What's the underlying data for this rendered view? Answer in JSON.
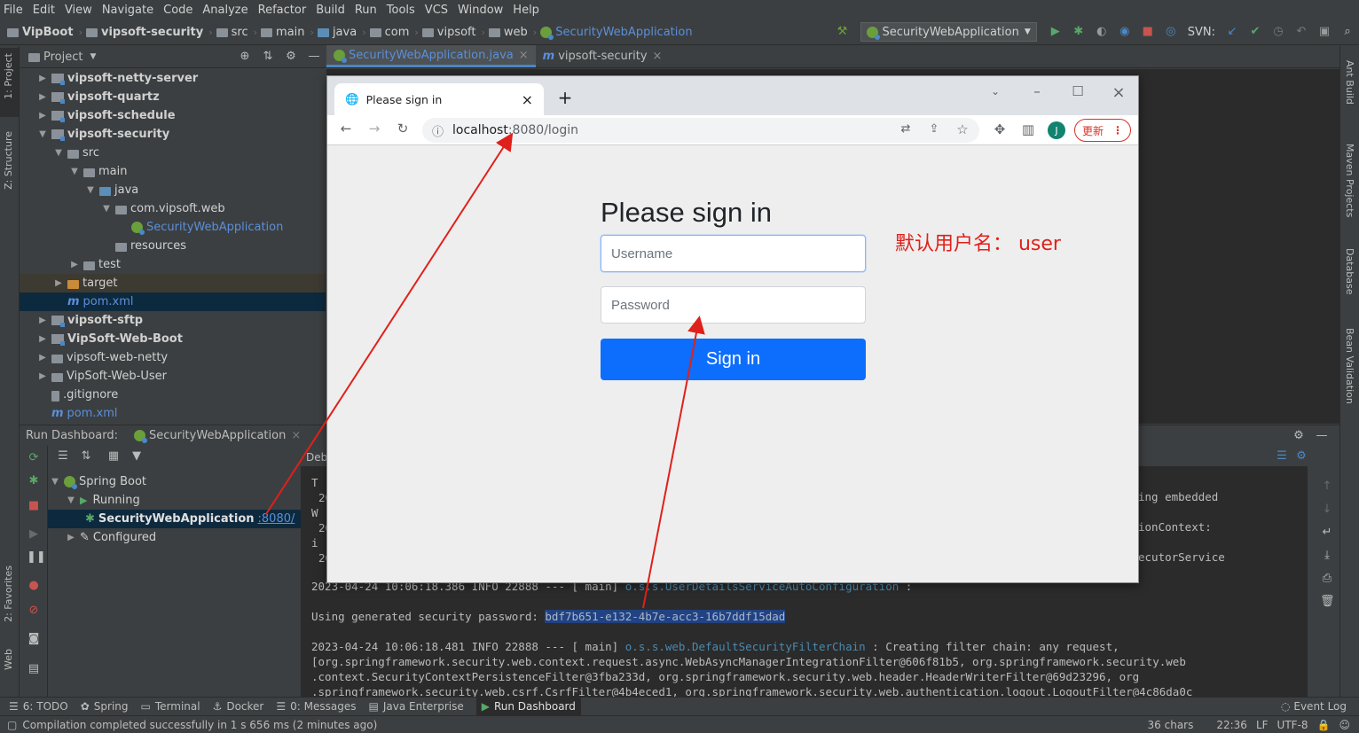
{
  "menu": [
    "File",
    "Edit",
    "View",
    "Navigate",
    "Code",
    "Analyze",
    "Refactor",
    "Build",
    "Run",
    "Tools",
    "VCS",
    "Window",
    "Help"
  ],
  "breadcrumbs": [
    "VipBoot",
    "vipsoft-security",
    "src",
    "main",
    "java",
    "com",
    "vipsoft",
    "web",
    "SecurityWebApplication"
  ],
  "run_config": "SecurityWebApplication",
  "svn_label": "SVN:",
  "left_strip": {
    "project": "1: Project",
    "structure": "Z: Structure",
    "favorites": "2: Favorites",
    "web": "Web"
  },
  "right_strip": {
    "ant": "Ant Build",
    "maven": "Maven Projects",
    "database": "Database",
    "bean": "Bean Validation"
  },
  "project_panel": {
    "title": "Project",
    "items": [
      {
        "label": "vipsoft-netty-server",
        "indent": 0,
        "type": "module",
        "arrow": "▶"
      },
      {
        "label": "vipsoft-quartz",
        "indent": 0,
        "type": "module",
        "arrow": "▶"
      },
      {
        "label": "vipsoft-schedule",
        "indent": 0,
        "type": "module",
        "arrow": "▶"
      },
      {
        "label": "vipsoft-security",
        "indent": 0,
        "type": "module",
        "arrow": "▼"
      },
      {
        "label": "src",
        "indent": 1,
        "type": "folder",
        "arrow": "▼"
      },
      {
        "label": "main",
        "indent": 2,
        "type": "folder",
        "arrow": "▼"
      },
      {
        "label": "java",
        "indent": 3,
        "type": "folder-blue",
        "arrow": "▼"
      },
      {
        "label": "com.vipsoft.web",
        "indent": 4,
        "type": "folder",
        "arrow": "▼"
      },
      {
        "label": "SecurityWebApplication",
        "indent": 5,
        "type": "spring",
        "arrow": ""
      },
      {
        "label": "resources",
        "indent": 4,
        "type": "folder",
        "arrow": ""
      },
      {
        "label": "test",
        "indent": 2,
        "type": "folder",
        "arrow": "▶"
      },
      {
        "label": "target",
        "indent": 1,
        "type": "folder-orange",
        "arrow": "▶"
      },
      {
        "label": "pom.xml",
        "indent": 1,
        "type": "maven",
        "arrow": ""
      },
      {
        "label": "vipsoft-sftp",
        "indent": 0,
        "type": "module",
        "arrow": "▶"
      },
      {
        "label": "VipSoft-Web-Boot",
        "indent": 0,
        "type": "module",
        "arrow": "▶"
      },
      {
        "label": "vipsoft-web-netty",
        "indent": 0,
        "type": "folder",
        "arrow": "▶"
      },
      {
        "label": "VipSoft-Web-User",
        "indent": 0,
        "type": "folder",
        "arrow": "▶"
      },
      {
        "label": ".gitignore",
        "indent": 0,
        "type": "file",
        "arrow": ""
      },
      {
        "label": "pom.xml",
        "indent": 0,
        "type": "maven",
        "arrow": ""
      }
    ]
  },
  "editor_tabs": [
    {
      "label": "SecurityWebApplication.java",
      "active": true
    },
    {
      "label": "vipsoft-security",
      "active": false
    }
  ],
  "run_dashboard": {
    "title": "Run Dashboard:",
    "tab": "SecurityWebApplication",
    "tree": [
      {
        "label": "Spring Boot",
        "indent": 0,
        "arrow": "▼"
      },
      {
        "label": "Running",
        "indent": 1,
        "arrow": "▼"
      },
      {
        "label": "SecurityWebApplication",
        "port": ":8080/",
        "indent": 2,
        "arrow": ""
      },
      {
        "label": "Configured",
        "indent": 1,
        "arrow": "▶"
      }
    ],
    "debug_tab": "Debu"
  },
  "console": {
    "right_fragments": [
      "ing embedded",
      "ionContext:",
      "ecutorService"
    ],
    "left_fragments": [
      "T",
      "20",
      "W",
      "20",
      "i",
      "20"
    ],
    "line_userdetails": {
      "prefix": "2023-04-24 10:06:18.386  INFO 22888 --- [           main] ",
      "logger": "o.s.s.UserDetailsServiceAutoConfiguration",
      "suffix": " :"
    },
    "pwd_prefix": "Using generated security password: ",
    "password": "bdf7b651-e132-4b7e-acc3-16b7ddf15dad",
    "line_chain_a": "2023-04-24 10:06:18.481  INFO 22888 --- [           main] ",
    "line_chain_logger": "o.s.s.web.DefaultSecurityFilterChain",
    "line_chain_b": "     : Creating filter chain: any request,",
    "line_chain_2": " [org.springframework.security.web.context.request.async.WebAsyncManagerIntegrationFilter@606f81b5, org.springframework.security.web",
    "line_chain_3": " .context.SecurityContextPersistenceFilter@3fba233d, org.springframework.security.web.header.HeaderWriterFilter@69d23296, org",
    "line_chain_4": " .springframework.security.web.csrf.CsrfFilter@4b4eced1, org.springframework.security.web.authentication.logout.LogoutFilter@4c86da0c"
  },
  "bottom_tabs": [
    {
      "label": "6: TODO",
      "active": false
    },
    {
      "label": "Spring",
      "active": false
    },
    {
      "label": "Terminal",
      "active": false
    },
    {
      "label": "Docker",
      "active": false
    },
    {
      "label": "0: Messages",
      "active": false
    },
    {
      "label": "Java Enterprise",
      "active": false
    },
    {
      "label": "Run Dashboard",
      "active": true
    }
  ],
  "event_log": "Event Log",
  "status": {
    "message": "Compilation completed successfully in 1 s 656 ms (2 minutes ago)",
    "chars": "36 chars",
    "position": "22:36",
    "line_sep": "LF",
    "encoding": "UTF-8"
  },
  "browser": {
    "tab_title": "Please sign in",
    "url_host": "localhost",
    "url_rest": ":8080/login",
    "avatar_letter": "J",
    "update_label": "更新",
    "heading": "Please sign in",
    "username_placeholder": "Username",
    "password_placeholder": "Password",
    "signin_label": "Sign in"
  },
  "annotation": "默认用户名： user",
  "colors": {
    "accent": "#0d6efd",
    "annotation": "#e0201a",
    "ide_bg": "#3c3f41",
    "console_bg": "#2b2b2b"
  }
}
